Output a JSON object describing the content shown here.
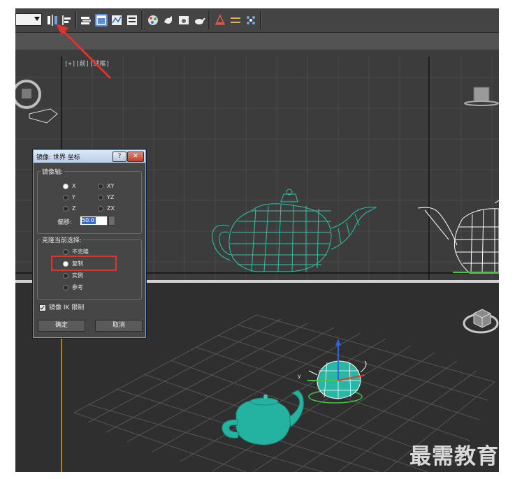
{
  "viewport_label": "[+][前][线框]",
  "dialog": {
    "title": "镜像: 世界 坐标",
    "help_label": "?",
    "close_label": "✕",
    "mirror_axis_group": "镜像轴:",
    "axes": [
      {
        "label": "X",
        "selected": true
      },
      {
        "label": "XY",
        "selected": false
      },
      {
        "label": "Y",
        "selected": false
      },
      {
        "label": "YZ",
        "selected": false
      },
      {
        "label": "Z",
        "selected": false
      },
      {
        "label": "ZX",
        "selected": false
      }
    ],
    "offset_label": "偏移:",
    "offset_value": "50.0",
    "clone_group": "克隆当前选择:",
    "clone_options": [
      {
        "label": "不克隆",
        "selected": false
      },
      {
        "label": "复制",
        "selected": true
      },
      {
        "label": "实例",
        "selected": false
      },
      {
        "label": "参考",
        "selected": false
      }
    ],
    "ik_label": "镜像 IK 限制",
    "ik_checked": true,
    "ok_label": "确定",
    "cancel_label": "取消"
  },
  "watermark": "最需教育",
  "colors": {
    "wireframe": "#2bc4a6",
    "selected_wire": "#ffffff",
    "teapot_solid": "#25b3a1",
    "annotation": "#e0332b",
    "toolbar_highlight": "#5b8dd6"
  },
  "icons": [
    "mirror-icon",
    "align-icon",
    "layer-icon",
    "scene-explorer-icon",
    "curve-editor-icon",
    "schematic-icon",
    "material-editor-icon",
    "render-setup-icon",
    "render-frame-icon",
    "render-teapot-icon",
    "xref-icon",
    "snaps-icon",
    "array-icon"
  ]
}
